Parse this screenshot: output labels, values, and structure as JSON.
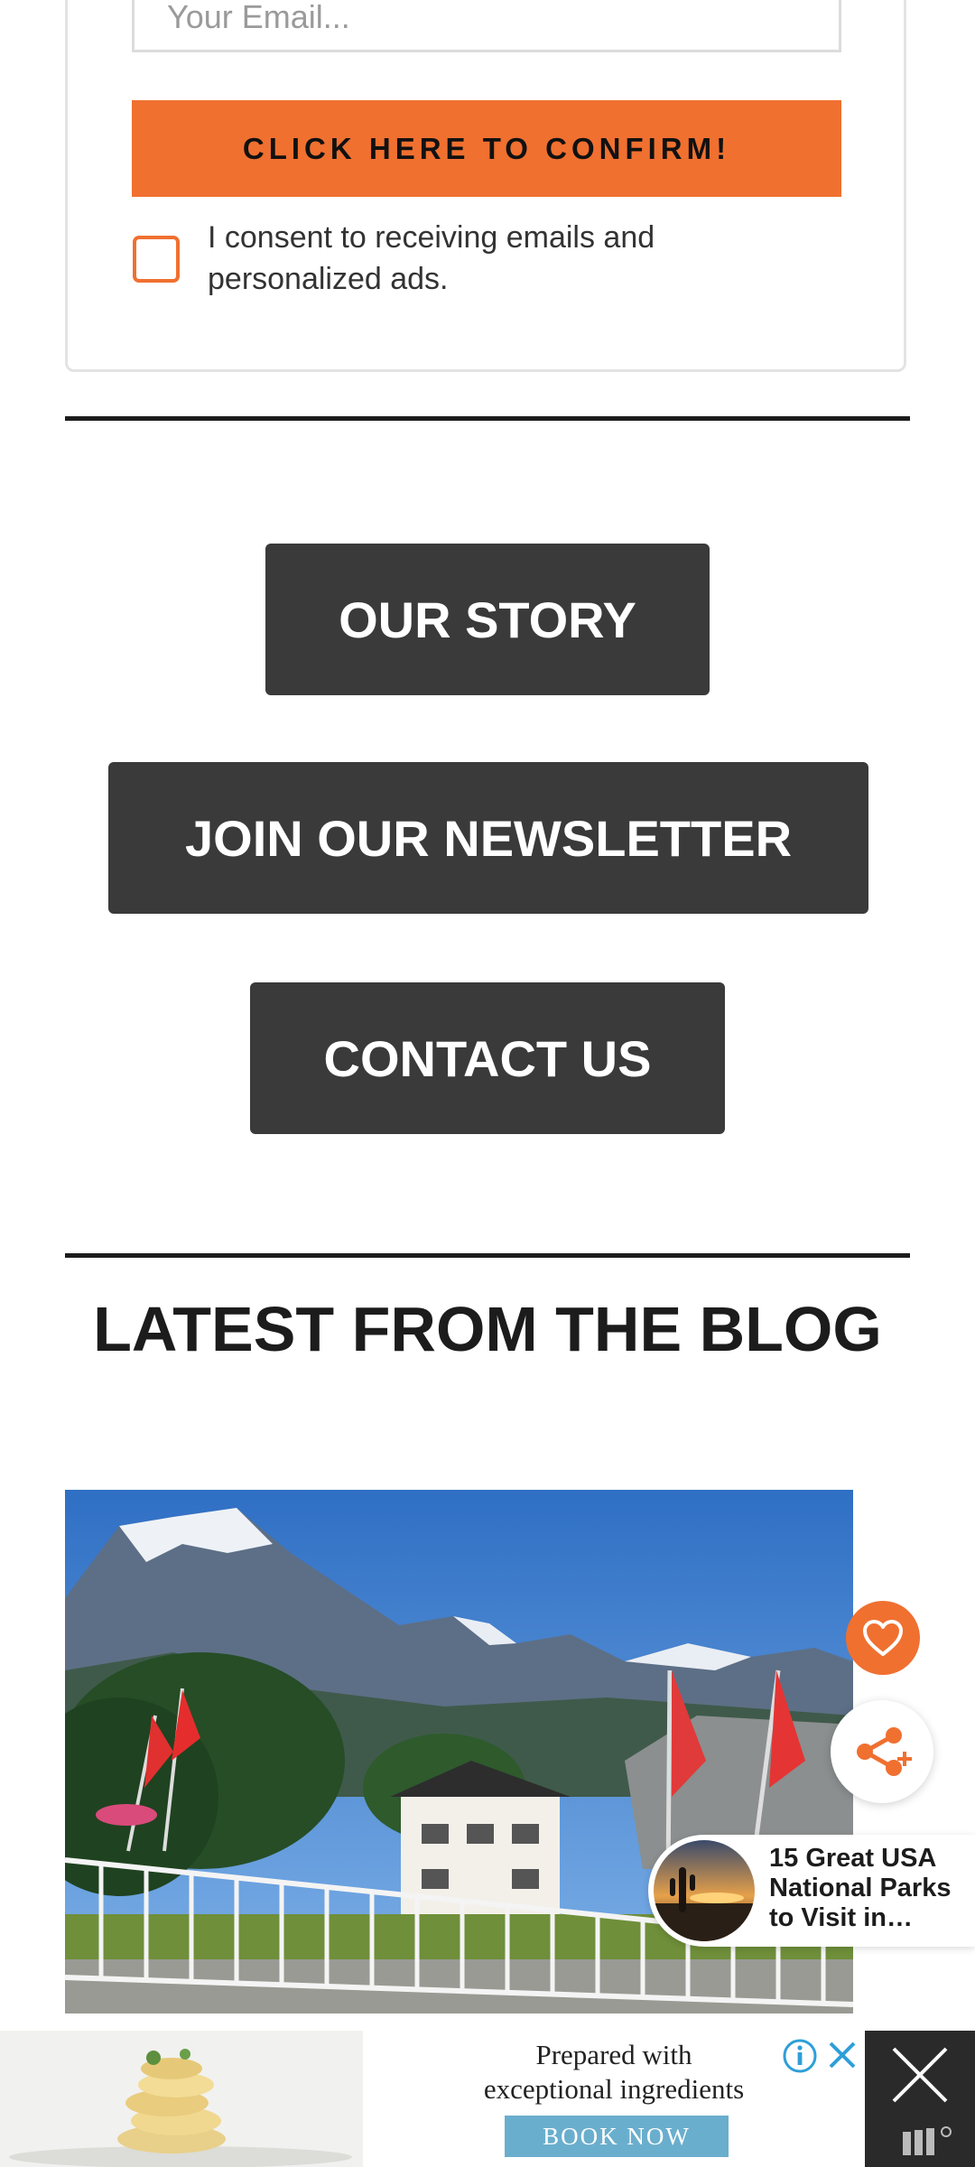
{
  "signup": {
    "email_placeholder": "Your Email...",
    "confirm_label": "CLICK HERE TO CONFIRM!",
    "consent_text": "I consent to receiving emails and personalized ads.",
    "consent_checked": false
  },
  "nav": {
    "our_story": "OUR STORY",
    "newsletter": "JOIN OUR NEWSLETTER",
    "contact": "CONTACT US"
  },
  "blog": {
    "heading": "LATEST FROM THE BLOG"
  },
  "floating": {
    "recommendation_title": "15 Great USA National Parks to Visit in…"
  },
  "ad": {
    "headline_line1": "Prepared with",
    "headline_line2": "exceptional ingredients",
    "cta": "BOOK NOW"
  },
  "colors": {
    "accent": "#f07030",
    "button_dark": "#3a3a3a",
    "ad_cta": "#6aaecd"
  },
  "icons": [
    "heart-icon",
    "share-icon",
    "info-icon",
    "close-icon",
    "ad-logo-icon"
  ]
}
